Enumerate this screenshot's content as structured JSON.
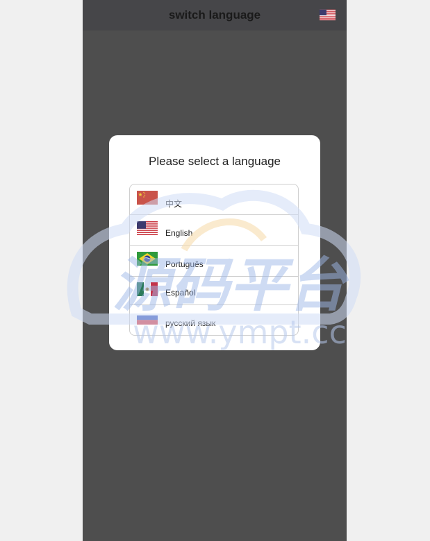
{
  "header": {
    "title": "switch language",
    "flag_icon": "us-flag-icon"
  },
  "modal": {
    "title": "Please select a language",
    "languages": [
      {
        "label": "中文",
        "flag": "cn-flag-icon"
      },
      {
        "label": "English",
        "flag": "us-flag-icon"
      },
      {
        "label": "Português",
        "flag": "br-flag-icon"
      },
      {
        "label": "Español",
        "flag": "mx-flag-icon"
      },
      {
        "label": "русский язык",
        "flag": "ru-flag-icon"
      }
    ]
  },
  "watermark": {
    "title": "源码平台",
    "url": "www.ympt.cc"
  },
  "colors": {
    "page_bg": "#f0f0f0",
    "app_bg": "#4e4e4e",
    "header_bg": "#464649",
    "modal_bg": "#ffffff",
    "border": "#cfcfcf"
  }
}
